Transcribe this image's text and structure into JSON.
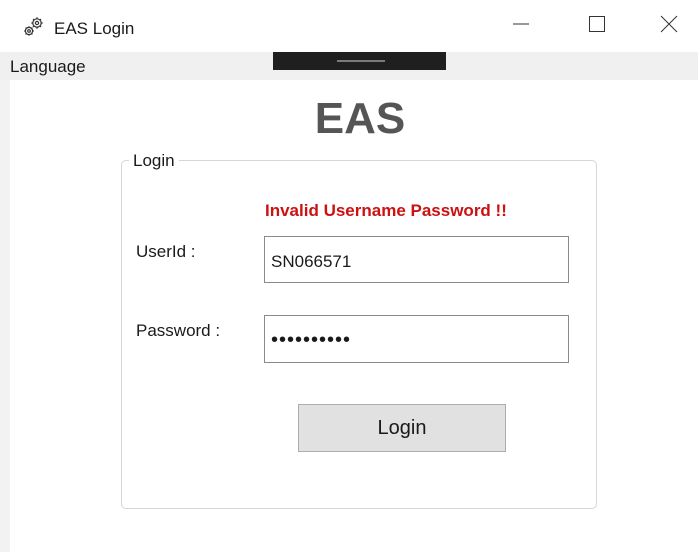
{
  "window": {
    "title": "EAS Login",
    "icon": "gears-icon",
    "controls": {
      "minimize": "minimize-icon",
      "maximize": "maximize-icon",
      "close": "close-icon"
    }
  },
  "menu": {
    "items": [
      {
        "label": "Language"
      }
    ]
  },
  "heading": "EAS",
  "login_group": {
    "legend": "Login",
    "error_message": "Invalid Username Password !!",
    "userid": {
      "label": "UserId :",
      "value": "SN066571"
    },
    "password": {
      "label": "Password :",
      "value": "••••••••••"
    },
    "submit_label": "Login"
  },
  "colors": {
    "error": "#cc1111",
    "heading": "#555555",
    "button_bg": "#e1e1e1",
    "menubar_bg": "#f0f0f0"
  }
}
